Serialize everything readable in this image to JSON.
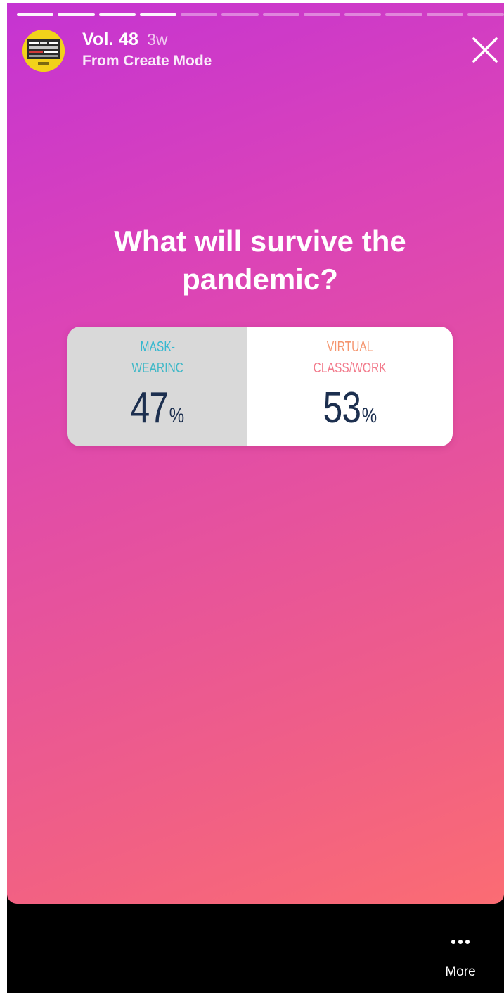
{
  "story": {
    "progress": {
      "total_segments": 12,
      "completed_segments": 4
    },
    "author": {
      "name": "Vol. 48",
      "time_ago": "3w",
      "subtitle": "From Create Mode"
    },
    "icons": {
      "close": "close-icon",
      "more": "more-dots-icon"
    },
    "colors": {
      "gradient_start": "#c534d2",
      "gradient_end": "#fb6c73",
      "poll_value_text": "#1c2f4f",
      "option_a_label": "#35b8d0",
      "option_b_label": "#f27b8c"
    }
  },
  "poll": {
    "question": "What will survive the pandemic?",
    "options": [
      {
        "label_line1": "MASK-",
        "label_line2": "WEARINC",
        "percent": "47",
        "suffix": "%"
      },
      {
        "label_line1": "VIRTUAL",
        "label_line2": "CLASS/WORK",
        "percent": "53",
        "suffix": "%"
      }
    ]
  },
  "footer": {
    "more_label": "More"
  }
}
